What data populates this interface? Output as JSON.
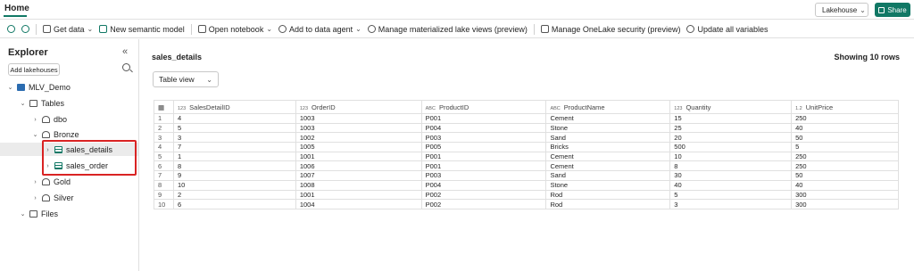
{
  "header": {
    "tab": "Home",
    "lakehouse_dropdown": "Lakehouse",
    "share": "Share"
  },
  "toolbar": {
    "items": [
      {
        "label": "Get data",
        "icon": "get-data-icon",
        "dropdown": true
      },
      {
        "label": "New semantic model",
        "icon": "semantic-model-icon"
      },
      {
        "label": "Open notebook",
        "icon": "notebook-icon",
        "dropdown": true
      },
      {
        "label": "Add to data agent",
        "icon": "data-agent-icon",
        "dropdown": true
      },
      {
        "label": "Manage materialized lake views (preview)",
        "icon": "lake-views-icon"
      },
      {
        "label": "Manage OneLake security (preview)",
        "icon": "security-icon"
      },
      {
        "label": "Update all variables",
        "icon": "variables-icon"
      }
    ]
  },
  "explorer": {
    "title": "Explorer",
    "add_lakehouses": "Add lakehouses",
    "tree": {
      "lakehouse": "MLV_Demo",
      "tables": "Tables",
      "dbo": "dbo",
      "bronze": "Bronze",
      "sales_details": "sales_details",
      "sales_order": "sales_order",
      "gold": "Gold",
      "silver": "Silver",
      "files": "Files"
    }
  },
  "main": {
    "table_title": "sales_details",
    "row_count": "Showing 10 rows",
    "view_mode": "Table view",
    "columns": [
      {
        "type": "123",
        "name": "SalesDetailID"
      },
      {
        "type": "123",
        "name": "OrderID"
      },
      {
        "type": "ABC",
        "name": "ProductID"
      },
      {
        "type": "ABC",
        "name": "ProductName"
      },
      {
        "type": "123",
        "name": "Quantity"
      },
      {
        "type": "1.2",
        "name": "UnitPrice"
      }
    ],
    "rows": [
      [
        "1",
        "4",
        "1003",
        "P001",
        "Cement",
        "15",
        "250"
      ],
      [
        "2",
        "5",
        "1003",
        "P004",
        "Stone",
        "25",
        "40"
      ],
      [
        "3",
        "3",
        "1002",
        "P003",
        "Sand",
        "20",
        "50"
      ],
      [
        "4",
        "7",
        "1005",
        "P005",
        "Bricks",
        "500",
        "5"
      ],
      [
        "5",
        "1",
        "1001",
        "P001",
        "Cement",
        "10",
        "250"
      ],
      [
        "6",
        "8",
        "1006",
        "P001",
        "Cement",
        "8",
        "250"
      ],
      [
        "7",
        "9",
        "1007",
        "P003",
        "Sand",
        "30",
        "50"
      ],
      [
        "8",
        "10",
        "1008",
        "P004",
        "Stone",
        "40",
        "40"
      ],
      [
        "9",
        "2",
        "1001",
        "P002",
        "Rod",
        "5",
        "300"
      ],
      [
        "10",
        "6",
        "1004",
        "P002",
        "Rod",
        "3",
        "300"
      ]
    ]
  }
}
